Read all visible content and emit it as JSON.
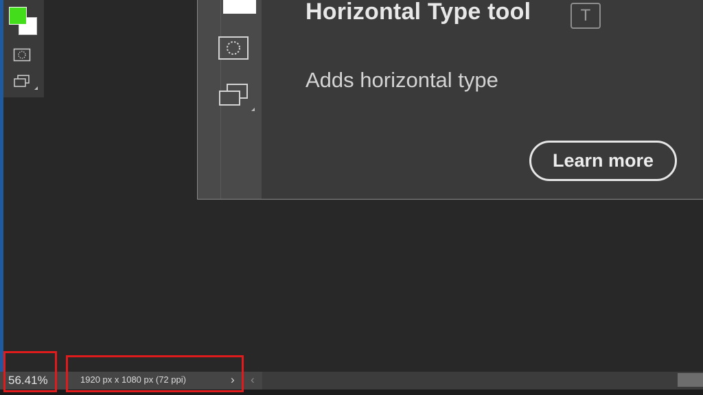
{
  "colors": {
    "foreground_swatch": "#44dd1c",
    "background_swatch": "#ffffff",
    "highlight": "#e01b1b",
    "canvas_bg": "#282828"
  },
  "toolbar": {
    "icons": [
      "foreground-color-swatch",
      "background-color-swatch",
      "quick-mask-icon",
      "screen-mode-icon"
    ]
  },
  "tooltip": {
    "tool_name": "Horizontal Type tool",
    "shortcut": "T",
    "description": "Adds horizontal type",
    "learn_more_label": "Learn more"
  },
  "status_bar": {
    "zoom": "56.41%",
    "document_info": "1920 px x 1080 px (72 ppi)",
    "info_arrow": "›",
    "scroll_left_arrow": "‹"
  }
}
